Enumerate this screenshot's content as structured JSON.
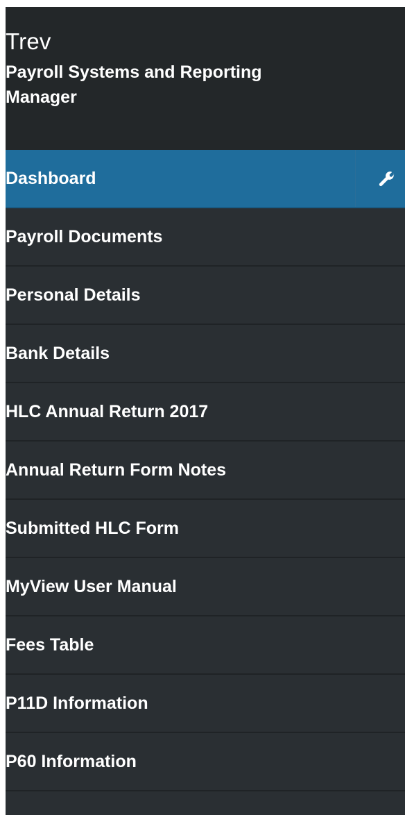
{
  "user": {
    "name": "Trev",
    "role": "Payroll Systems and Reporting Manager"
  },
  "colors": {
    "sidebar_bg": "#2a2f33",
    "header_bg": "#232729",
    "active_bg": "#1f6d9c",
    "text": "#ffffff"
  },
  "menu": {
    "items": [
      {
        "label": "Dashboard",
        "active": true,
        "icon": "wrench-icon"
      },
      {
        "label": "Payroll Documents"
      },
      {
        "label": "Personal Details"
      },
      {
        "label": "Bank Details"
      },
      {
        "label": "HLC Annual Return 2017"
      },
      {
        "label": "Annual Return Form Notes"
      },
      {
        "label": "Submitted HLC Form"
      },
      {
        "label": "MyView User Manual"
      },
      {
        "label": "Fees Table"
      },
      {
        "label": "P11D Information"
      },
      {
        "label": "P60 Information"
      }
    ]
  }
}
